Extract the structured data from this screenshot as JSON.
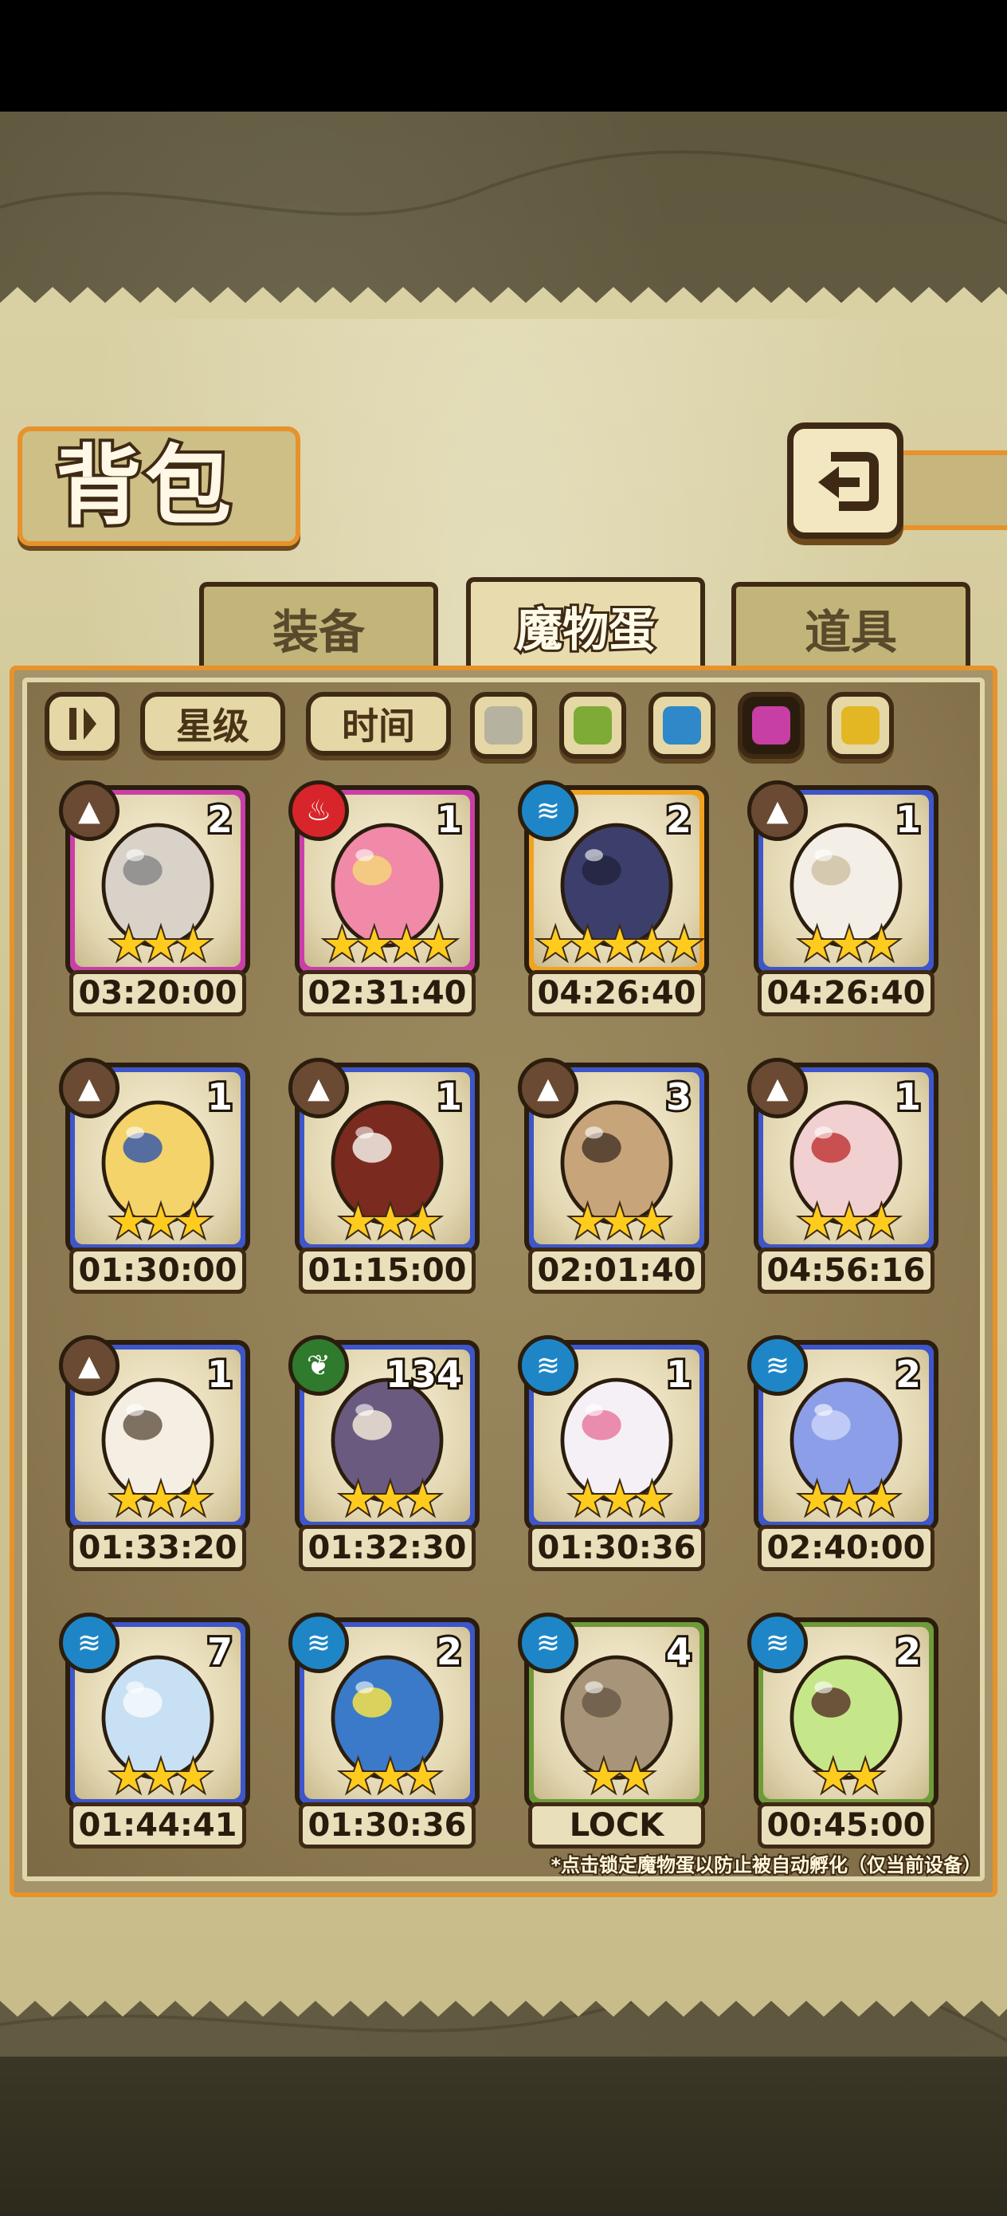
{
  "title": "背包",
  "tabs": [
    {
      "label": "装备",
      "active": false
    },
    {
      "label": "魔物蛋",
      "active": true
    },
    {
      "label": "道具",
      "active": false
    }
  ],
  "filters": {
    "sort_star": "星级",
    "sort_time": "时间",
    "colors": [
      {
        "name": "grey",
        "color": "#b6b2a0",
        "selected": false
      },
      {
        "name": "green",
        "color": "#7dab35",
        "selected": false
      },
      {
        "name": "blue",
        "color": "#2f88c8",
        "selected": false
      },
      {
        "name": "purple",
        "color": "#c73fa4",
        "selected": true
      },
      {
        "name": "gold",
        "color": "#e3b624",
        "selected": false
      }
    ]
  },
  "eggs": [
    {
      "element": "earth",
      "count": "2",
      "stars": "★★★",
      "timer": "03:20:00",
      "rarity": "purple"
    },
    {
      "element": "fire",
      "count": "1",
      "stars": "★★★★",
      "timer": "02:31:40",
      "rarity": "purple"
    },
    {
      "element": "water",
      "count": "2",
      "stars": "★★★★★",
      "timer": "04:26:40",
      "rarity": "gold"
    },
    {
      "element": "earth",
      "count": "1",
      "stars": "★★★",
      "timer": "04:26:40",
      "rarity": "blue"
    },
    {
      "element": "earth",
      "count": "1",
      "stars": "★★★",
      "timer": "01:30:00",
      "rarity": "blue"
    },
    {
      "element": "earth",
      "count": "1",
      "stars": "★★★",
      "timer": "01:15:00",
      "rarity": "blue"
    },
    {
      "element": "earth",
      "count": "3",
      "stars": "★★★",
      "timer": "02:01:40",
      "rarity": "blue"
    },
    {
      "element": "earth",
      "count": "1",
      "stars": "★★★",
      "timer": "04:56:16",
      "rarity": "blue"
    },
    {
      "element": "earth",
      "count": "1",
      "stars": "★★★",
      "timer": "01:33:20",
      "rarity": "blue"
    },
    {
      "element": "wood",
      "count": "134",
      "stars": "★★★",
      "timer": "01:32:30",
      "rarity": "blue"
    },
    {
      "element": "water",
      "count": "1",
      "stars": "★★★",
      "timer": "01:30:36",
      "rarity": "blue"
    },
    {
      "element": "water",
      "count": "2",
      "stars": "★★★",
      "timer": "02:40:00",
      "rarity": "blue"
    },
    {
      "element": "water",
      "count": "7",
      "stars": "★★★",
      "timer": "01:44:41",
      "rarity": "blue"
    },
    {
      "element": "water",
      "count": "2",
      "stars": "★★★",
      "timer": "01:30:36",
      "rarity": "blue"
    },
    {
      "element": "water",
      "count": "4",
      "stars": "★★",
      "timer": "LOCK",
      "rarity": "green"
    },
    {
      "element": "water",
      "count": "2",
      "stars": "★★",
      "timer": "00:45:00",
      "rarity": "green"
    }
  ],
  "colors": {
    "rarity_purple": "#c83fa8",
    "rarity_gold": "#f0a321",
    "rarity_blue": "#3d56c9",
    "rarity_green": "#6f9a3a",
    "elem_earth": "#6a4a32",
    "elem_fire": "#d8242b",
    "elem_water": "#1e86c7",
    "elem_wood": "#2f7a2d"
  },
  "note": "*点击锁定魔物蛋以防止被自动孵化（仅当前设备）"
}
